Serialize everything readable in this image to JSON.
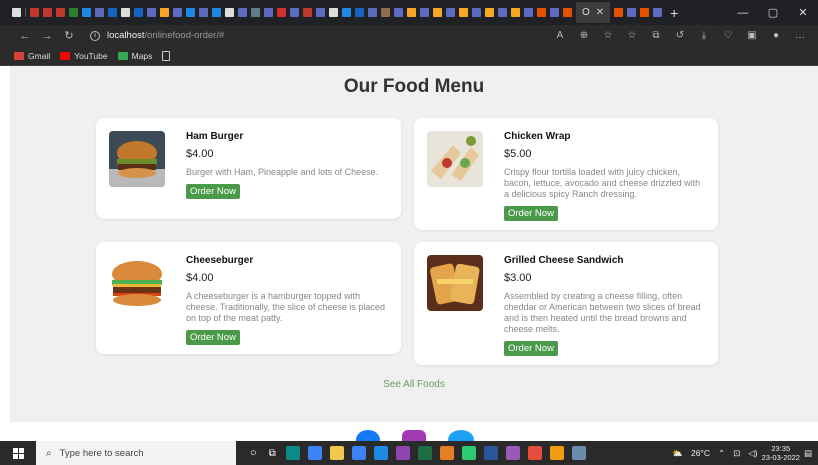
{
  "browser": {
    "active_tab_title": "O",
    "new_tab_glyph": "+",
    "url_host": "localhost",
    "url_path": "/onlinefood-order/#",
    "bookmarks": [
      {
        "label": "Gmail",
        "color": "#d44638"
      },
      {
        "label": "YouTube",
        "color": "#ff0000"
      },
      {
        "label": "Maps",
        "color": "#34a853"
      }
    ]
  },
  "page": {
    "title": "Our Food Menu",
    "order_label": "Order Now",
    "see_all": "See All Foods",
    "foods": [
      {
        "name": "Ham Burger",
        "price": "$4.00",
        "description": "Burger with Ham, Pineapple and lots of Cheese."
      },
      {
        "name": "Chicken Wrap",
        "price": "$5.00",
        "description": "Crispy flour tortilla loaded with juicy chicken, bacon, lettuce, avocado and cheese drizzled with a delicious spicy Ranch dressing."
      },
      {
        "name": "Cheeseburger",
        "price": "$4.00",
        "description": "A cheeseburger is a hamburger topped with cheese. Traditionally, the slice of cheese is placed on top of the meat patty."
      },
      {
        "name": "Grilled Cheese Sandwich",
        "price": "$3.00",
        "description": "Assembled by creating a cheese filling, often cheddar or American between two slices of bread and is then heated until the bread browns and cheese melts."
      }
    ]
  },
  "taskbar": {
    "search_placeholder": "Type here to search",
    "temperature": "26°C",
    "time": "23:35",
    "date": "23-03-2022"
  },
  "colors": {
    "order_button": "#4a9a4a",
    "page_background": "#f0f0f0",
    "see_all_link": "#6a9a6a"
  }
}
